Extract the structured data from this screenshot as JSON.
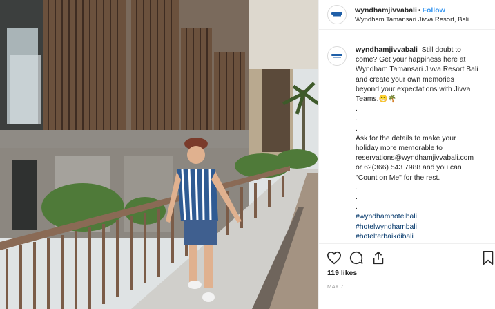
{
  "post": {
    "username": "wyndhamjivvabali",
    "follow_label": "Follow",
    "separator": "•",
    "location": "Wyndham Tamansari Jivva Resort, Bali"
  },
  "caption": {
    "username": "wyndhamjivvabali",
    "lines": [
      "Still doubt to",
      "come? Get your happiness here at",
      "Wyndham Tamansari Jivva Resort Bali",
      "and create your own memories",
      "beyond your expectations with Jivva",
      "Teams.😁🌴",
      ".",
      ".",
      ".",
      "Ask for the details to make your",
      "holiday more memorable to",
      "reservations@wyndhamjivvabali.com",
      "or 62(366) 543 7988 and you can",
      "\"Count on Me\" for the rest.",
      ".",
      ".",
      "."
    ],
    "hashtags": [
      "#wyndhamhotelbali",
      "#hotelwyndhambali",
      "#hotelterbaikdibali"
    ]
  },
  "actions": {
    "like_icon": "heart-icon",
    "comment_icon": "comment-icon",
    "share_icon": "share-icon",
    "save_icon": "bookmark-icon"
  },
  "likes": "119 likes",
  "date": "MAY 7",
  "colors": {
    "link": "#003569",
    "follow": "#3897f0",
    "muted": "#999999",
    "border": "#efefef"
  }
}
